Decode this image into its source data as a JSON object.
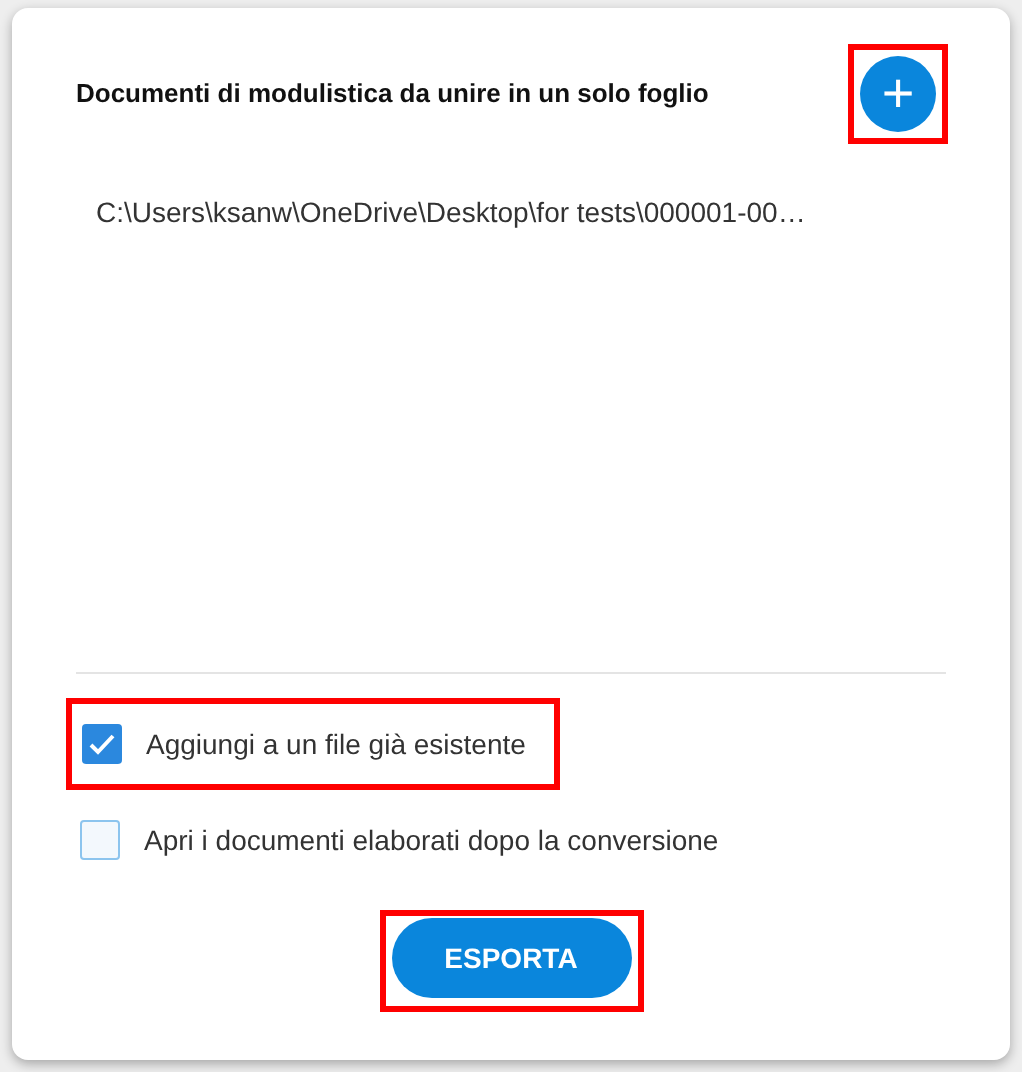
{
  "dialog": {
    "title": "Documenti di modulistica da unire in un solo foglio",
    "add_button": {
      "label": "+",
      "highlighted": true
    },
    "files": [
      "C:\\Users\\ksanw\\OneDrive\\Desktop\\for tests\\000001-00…"
    ],
    "options": [
      {
        "label": "Aggiungi a un file già esistente",
        "checked": true,
        "highlighted": true
      },
      {
        "label": "Apri i documenti elaborati dopo la conversione",
        "checked": false,
        "highlighted": false
      }
    ],
    "export_button": {
      "label": "ESPORTA",
      "highlighted": true
    }
  }
}
